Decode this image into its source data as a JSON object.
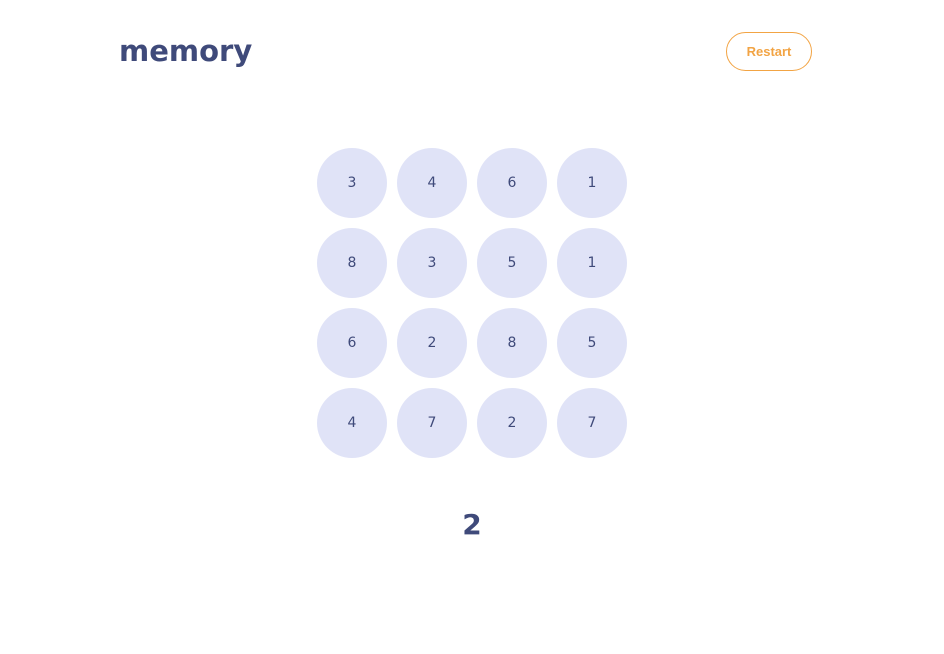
{
  "header": {
    "logo": "memory",
    "restart_label": "Restart"
  },
  "board": {
    "tiles": [
      "3",
      "4",
      "6",
      "1",
      "8",
      "3",
      "5",
      "1",
      "6",
      "2",
      "8",
      "5",
      "4",
      "7",
      "2",
      "7"
    ]
  },
  "score": "2",
  "colors": {
    "brand": "#3f4a7a",
    "accent": "#f2a444",
    "tile": "#e0e3f7"
  }
}
